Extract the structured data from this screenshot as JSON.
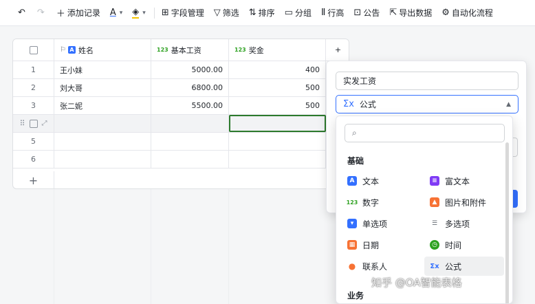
{
  "toolbar": {
    "add_record": "添加记录",
    "field_manage": "字段管理",
    "filter": "筛选",
    "sort": "排序",
    "group": "分组",
    "row_height": "行高",
    "notice": "公告",
    "export": "导出数据",
    "automation": "自动化流程"
  },
  "table": {
    "columns": [
      "姓名",
      "基本工资",
      "奖金"
    ],
    "rows": [
      {
        "n": "1",
        "name": "王小妹",
        "salary": "5000.00",
        "bonus": "400"
      },
      {
        "n": "2",
        "name": "刘大哥",
        "salary": "6800.00",
        "bonus": "500"
      },
      {
        "n": "3",
        "name": "张二妮",
        "salary": "5500.00",
        "bonus": "500"
      },
      {
        "n": "",
        "name": "",
        "salary": "",
        "bonus": ""
      },
      {
        "n": "5",
        "name": "",
        "salary": "",
        "bonus": ""
      },
      {
        "n": "6",
        "name": "",
        "salary": "",
        "bonus": ""
      }
    ]
  },
  "panel": {
    "field_name": "实发工资",
    "field_type": "公式"
  },
  "dropdown": {
    "search_placeholder": "",
    "sections": [
      "基础",
      "业务"
    ],
    "items": [
      {
        "label": "文本",
        "icon": "text-icon",
        "color": "#3370ff"
      },
      {
        "label": "富文本",
        "icon": "rich-text-icon",
        "color": "#7f3bf5"
      },
      {
        "label": "数字",
        "icon": "number-icon",
        "color": "#2ea121"
      },
      {
        "label": "图片和附件",
        "icon": "image-icon",
        "color": "#f77234"
      },
      {
        "label": "单选项",
        "icon": "single-select-icon",
        "color": "#3370ff"
      },
      {
        "label": "多选项",
        "icon": "multi-select-icon",
        "color": "#646a73"
      },
      {
        "label": "日期",
        "icon": "date-icon",
        "color": "#f77234"
      },
      {
        "label": "时间",
        "icon": "time-icon",
        "color": "#2ea121"
      },
      {
        "label": "联系人",
        "icon": "contact-icon",
        "color": "#f77234"
      },
      {
        "label": "公式",
        "icon": "formula-icon",
        "color": "#3370ff"
      }
    ]
  },
  "watermark": "知乎 @OA智能表格"
}
